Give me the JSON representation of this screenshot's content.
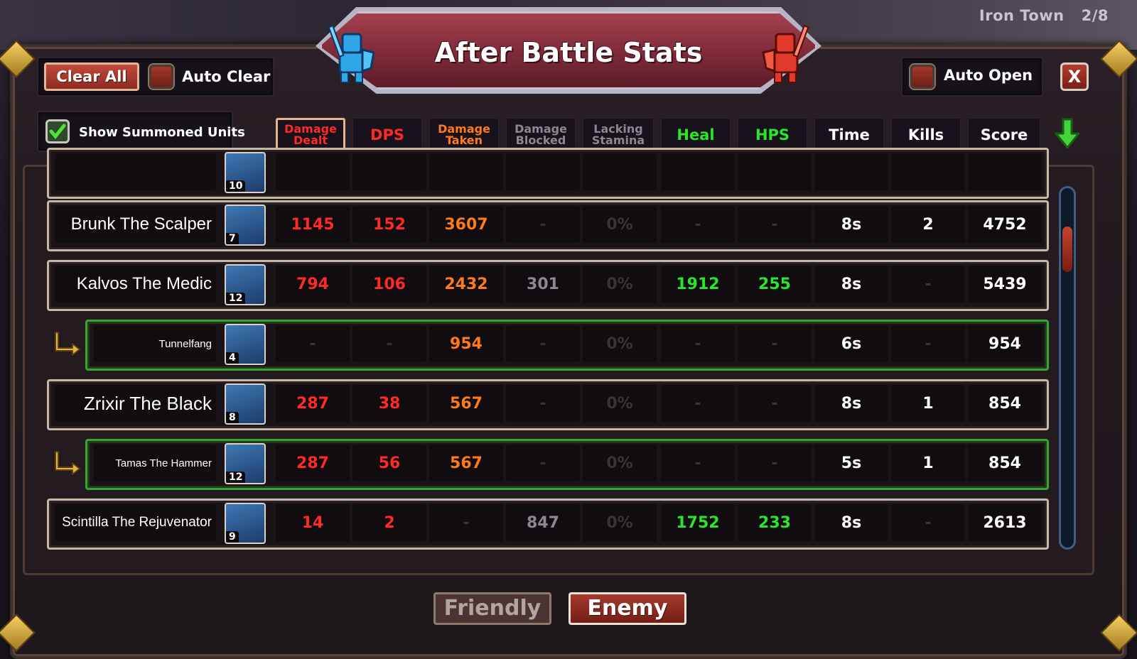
{
  "location": {
    "name": "Iron Town",
    "progress": "2/8"
  },
  "title": "After Battle Stats",
  "controls": {
    "clear_all": "Clear All",
    "auto_clear": "Auto Clear",
    "auto_open": "Auto Open",
    "close": "X",
    "show_summoned_units": "Show Summoned Units"
  },
  "columns": [
    {
      "key": "damage_dealt",
      "label": "Damage Dealt",
      "color": "#ff2a24",
      "active": true
    },
    {
      "key": "dps",
      "label": "DPS",
      "color": "#ff2a24"
    },
    {
      "key": "damage_taken",
      "label": "Damage Taken",
      "color": "#ff7a18"
    },
    {
      "key": "damage_blocked",
      "label": "Damage Blocked",
      "color": "#8c8890"
    },
    {
      "key": "lacking_stamina",
      "label": "Lacking Stamina",
      "color": "#8c8890"
    },
    {
      "key": "heal",
      "label": "Heal",
      "color": "#29e629"
    },
    {
      "key": "hps",
      "label": "HPS",
      "color": "#29e629"
    },
    {
      "key": "time",
      "label": "Time",
      "color": "#ffffff"
    },
    {
      "key": "kills",
      "label": "Kills",
      "color": "#ffffff"
    },
    {
      "key": "score",
      "label": "Score",
      "color": "#ffffff"
    }
  ],
  "rows": [
    {
      "name": "",
      "level": "10",
      "summon": false,
      "portrait": "hero-portrait",
      "values": [
        "",
        "",
        "",
        "",
        "",
        "",
        "",
        "",
        "",
        ""
      ]
    },
    {
      "name": "Brunk The Scalper",
      "level": "7",
      "summon": false,
      "portrait": "brunk-portrait",
      "values": [
        "1145",
        "152",
        "3607",
        "-",
        "0%",
        "-",
        "-",
        "8s",
        "2",
        "4752"
      ]
    },
    {
      "name": "Kalvos The Medic",
      "level": "12",
      "summon": false,
      "portrait": "kalvos-portrait",
      "values": [
        "794",
        "106",
        "2432",
        "301",
        "0%",
        "1912",
        "255",
        "8s",
        "-",
        "5439"
      ]
    },
    {
      "name": "Tunnelfang",
      "level": "4",
      "summon": true,
      "portrait": "tunnelfang-portrait",
      "values": [
        "-",
        "-",
        "954",
        "-",
        "0%",
        "-",
        "-",
        "6s",
        "-",
        "954"
      ]
    },
    {
      "name": "Zrixir The Black",
      "level": "8",
      "summon": false,
      "portrait": "zrixir-portrait",
      "values": [
        "287",
        "38",
        "567",
        "-",
        "0%",
        "-",
        "-",
        "8s",
        "1",
        "854"
      ]
    },
    {
      "name": "Tamas The Hammer",
      "level": "12",
      "summon": true,
      "portrait": "tamas-portrait",
      "values": [
        "287",
        "56",
        "567",
        "-",
        "0%",
        "-",
        "-",
        "5s",
        "1",
        "854"
      ]
    },
    {
      "name": "Scintilla The Rejuvenator",
      "level": "9",
      "summon": false,
      "portrait": "scintilla-portrait",
      "values": [
        "14",
        "2",
        "-",
        "847",
        "0%",
        "1752",
        "233",
        "8s",
        "-",
        "2613"
      ]
    }
  ],
  "tabs": {
    "friendly": "Friendly",
    "enemy": "Enemy",
    "selected": "enemy"
  },
  "colors": {
    "damage": "#ff2a24",
    "taken": "#ff7a18",
    "heal": "#29e629",
    "dim": "#3a3437",
    "summon_border": "#3ba431"
  }
}
